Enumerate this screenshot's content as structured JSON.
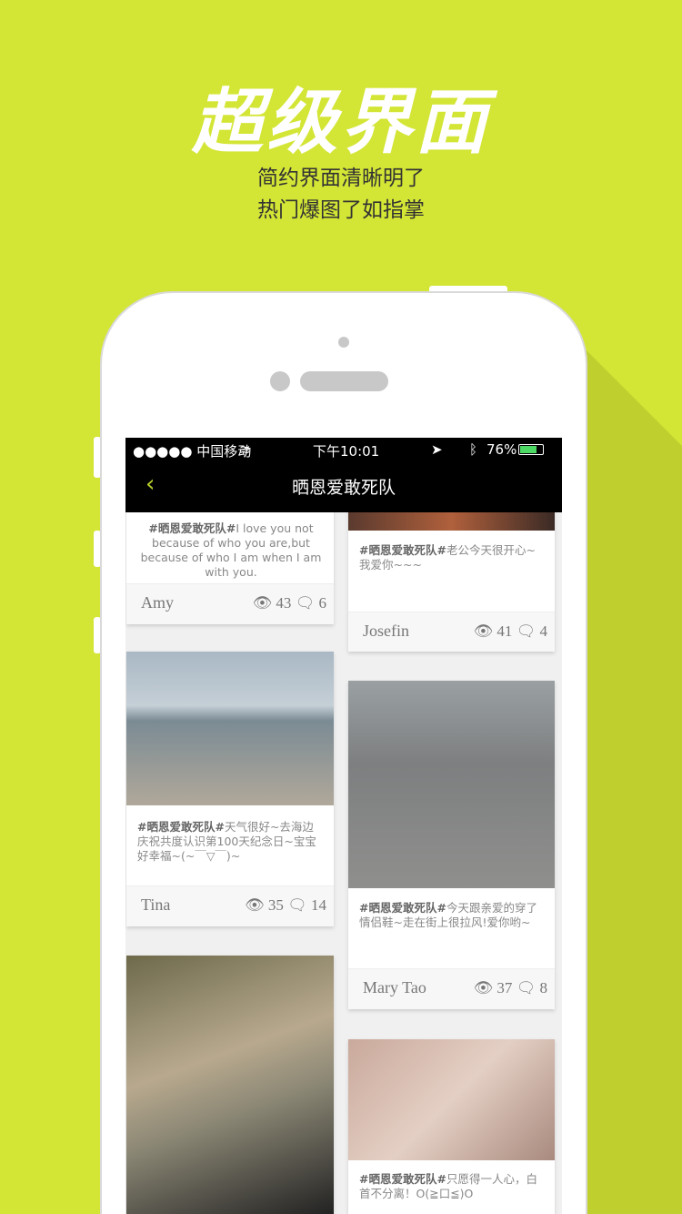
{
  "promo": {
    "title": "超级界面",
    "line1": "简约界面清晰明了",
    "line2": "热门爆图了如指掌"
  },
  "colors": {
    "background": "#d3e535",
    "accent": "#b9cf2c"
  },
  "status_bar": {
    "carrier": "●●●●● 中国移动",
    "time": "下午10:01",
    "battery": "76%"
  },
  "nav": {
    "title": "晒恩爱敢死队",
    "back_icon": "chevron-left-icon"
  },
  "posts": [
    {
      "tag": "#晒恩爱敢死队#",
      "text": "I love you not because of who you are,but because of who I am when I am with you.",
      "author": "Amy",
      "views": "43",
      "comments": "6"
    },
    {
      "tag": "#晒恩爱敢死队#",
      "text": "老公今天很开心~我爱你~~~",
      "author": "Josefin",
      "views": "41",
      "comments": "4"
    },
    {
      "tag": "#晒恩爱敢死队#",
      "text": "天气很好~去海边庆祝共度认识第100天纪念日~宝宝好幸福~(~￣▽￣)~",
      "author": "Tina",
      "views": "35",
      "comments": "14"
    },
    {
      "tag": "#晒恩爱敢死队#",
      "text": "今天跟亲爱的穿了情侣鞋~走在街上很拉风!爱你哟~",
      "author": "Mary Tao",
      "views": "37",
      "comments": "8"
    },
    {
      "tag": "#晒恩爱敢死队#",
      "text": "只愿得一人心，白首不分离！O(≧口≦)O"
    }
  ]
}
